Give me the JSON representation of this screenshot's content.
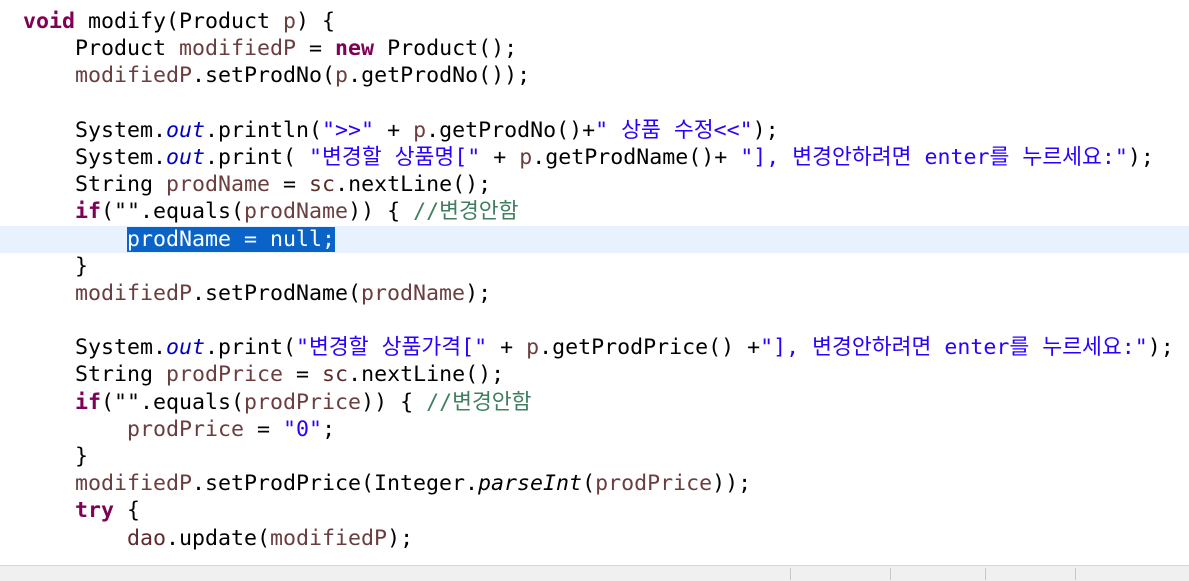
{
  "editor": {
    "colors": {
      "keyword": "#7f0055",
      "field": "#5e2b2b",
      "local_variable": "#6a3e3e",
      "static_field": "#0000c0",
      "string": "#2a00ff",
      "comment": "#3f7f5f",
      "selection": "#0a64c8",
      "current_line": "#e8f2fe"
    },
    "lines": [
      {
        "segments": [
          {
            "t": "void",
            "c": "kw"
          },
          {
            "t": " modify(Product "
          },
          {
            "t": "p",
            "c": "vr"
          },
          {
            "t": ") {"
          }
        ]
      },
      {
        "segments": [
          {
            "t": "    Product "
          },
          {
            "t": "modifiedP",
            "c": "vr"
          },
          {
            "t": " = "
          },
          {
            "t": "new",
            "c": "kw"
          },
          {
            "t": " Product();"
          }
        ]
      },
      {
        "segments": [
          {
            "t": "    "
          },
          {
            "t": "modifiedP",
            "c": "vr"
          },
          {
            "t": ".setProdNo("
          },
          {
            "t": "p",
            "c": "vr"
          },
          {
            "t": ".getProdNo());"
          }
        ]
      },
      {
        "segments": []
      },
      {
        "segments": [
          {
            "t": "    System."
          },
          {
            "t": "out",
            "c": "st it"
          },
          {
            "t": ".println("
          },
          {
            "t": "\">>\"",
            "c": "str"
          },
          {
            "t": " + "
          },
          {
            "t": "p",
            "c": "vr"
          },
          {
            "t": ".getProdNo()+"
          },
          {
            "t": "\" 상품 수정<<\"",
            "c": "str"
          },
          {
            "t": ");"
          }
        ]
      },
      {
        "segments": [
          {
            "t": "    System."
          },
          {
            "t": "out",
            "c": "st it"
          },
          {
            "t": ".print( "
          },
          {
            "t": "\"변경할 상품명[\"",
            "c": "str"
          },
          {
            "t": " + "
          },
          {
            "t": "p",
            "c": "vr"
          },
          {
            "t": ".getProdName()+ "
          },
          {
            "t": "\"], 변경안하려면 enter를 누르세요:\"",
            "c": "str"
          },
          {
            "t": ");"
          }
        ]
      },
      {
        "segments": [
          {
            "t": "    String "
          },
          {
            "t": "prodName",
            "c": "vr"
          },
          {
            "t": " = "
          },
          {
            "t": "sc",
            "c": "fld"
          },
          {
            "t": ".nextLine();"
          }
        ]
      },
      {
        "segments": [
          {
            "t": "    "
          },
          {
            "t": "if",
            "c": "kw"
          },
          {
            "t": "(\"\".equals("
          },
          {
            "t": "prodName",
            "c": "vr"
          },
          {
            "t": ")) { "
          },
          {
            "t": "//변경안함",
            "c": "cmt"
          }
        ]
      },
      {
        "current": true,
        "segments": [
          {
            "t": "        "
          },
          {
            "t": "prodName = null;",
            "c": "sel"
          }
        ]
      },
      {
        "segments": [
          {
            "t": "    }"
          }
        ]
      },
      {
        "segments": [
          {
            "t": "    "
          },
          {
            "t": "modifiedP",
            "c": "vr"
          },
          {
            "t": ".setProdName("
          },
          {
            "t": "prodName",
            "c": "vr"
          },
          {
            "t": ");"
          }
        ]
      },
      {
        "segments": []
      },
      {
        "segments": [
          {
            "t": "    System."
          },
          {
            "t": "out",
            "c": "st it"
          },
          {
            "t": ".print("
          },
          {
            "t": "\"변경할 상품가격[\"",
            "c": "str"
          },
          {
            "t": " + "
          },
          {
            "t": "p",
            "c": "vr"
          },
          {
            "t": ".getProdPrice() +"
          },
          {
            "t": "\"], 변경안하려면 enter를 누르세요:\"",
            "c": "str"
          },
          {
            "t": ");"
          }
        ]
      },
      {
        "segments": [
          {
            "t": "    String "
          },
          {
            "t": "prodPrice",
            "c": "vr"
          },
          {
            "t": " = "
          },
          {
            "t": "sc",
            "c": "fld"
          },
          {
            "t": ".nextLine();"
          }
        ]
      },
      {
        "segments": [
          {
            "t": "    "
          },
          {
            "t": "if",
            "c": "kw"
          },
          {
            "t": "(\"\".equals("
          },
          {
            "t": "prodPrice",
            "c": "vr"
          },
          {
            "t": ")) { "
          },
          {
            "t": "//변경안함",
            "c": "cmt"
          }
        ]
      },
      {
        "segments": [
          {
            "t": "        "
          },
          {
            "t": "prodPrice",
            "c": "vr"
          },
          {
            "t": " = "
          },
          {
            "t": "\"0\"",
            "c": "str"
          },
          {
            "t": ";"
          }
        ]
      },
      {
        "segments": [
          {
            "t": "    }"
          }
        ]
      },
      {
        "segments": [
          {
            "t": "    "
          },
          {
            "t": "modifiedP",
            "c": "vr"
          },
          {
            "t": ".setProdPrice(Integer."
          },
          {
            "t": "parseInt",
            "c": "it"
          },
          {
            "t": "("
          },
          {
            "t": "prodPrice",
            "c": "vr"
          },
          {
            "t": "));"
          }
        ]
      },
      {
        "segments": [
          {
            "t": "    "
          },
          {
            "t": "try",
            "c": "kw"
          },
          {
            "t": " {"
          }
        ]
      },
      {
        "segments": [
          {
            "t": "        "
          },
          {
            "t": "dao",
            "c": "fld"
          },
          {
            "t": ".update("
          },
          {
            "t": "modifiedP",
            "c": "vr"
          },
          {
            "t": ");"
          }
        ]
      }
    ]
  }
}
